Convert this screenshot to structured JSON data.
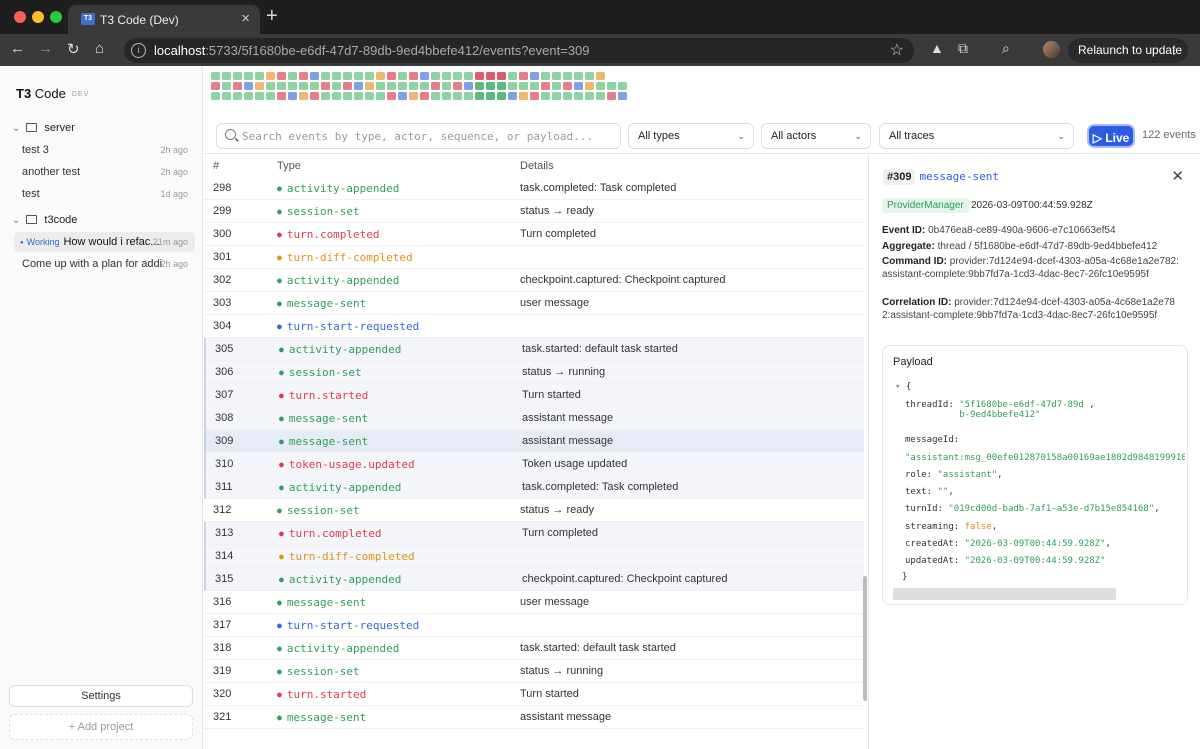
{
  "browser": {
    "tab_title": "T3 Code (Dev)",
    "tab_icon": "T3",
    "url_host": "localhost",
    "url_rest": ":5733/5f1680be-e6df-47d7-89db-9ed4bbefe412/events?event=309",
    "relaunch_label": "Relaunch to update"
  },
  "sidebar": {
    "brand": "T3",
    "brand_rest": " Code",
    "brand_badge": "DEV",
    "groups": [
      {
        "name": "server",
        "threads": [
          {
            "title": "test 3",
            "age": "2h ago"
          },
          {
            "title": "another test",
            "age": "2h ago"
          },
          {
            "title": "test",
            "age": "1d ago"
          }
        ]
      },
      {
        "name": "t3code",
        "threads": [
          {
            "status": "Working",
            "title": "How would i refac...",
            "age": "21m ago"
          },
          {
            "title": "Come up with a plan for addi...",
            "age": "2h ago"
          }
        ]
      }
    ],
    "settings_label": "Settings",
    "add_project_label": "+ Add project"
  },
  "toolbar": {
    "search_placeholder": "Search events by type, actor, sequence, or payload...",
    "types_filter": "All types",
    "actors_filter": "All actors",
    "traces_filter": "All traces",
    "live_label": "Live",
    "event_count": "122 events"
  },
  "table": {
    "headers": {
      "seq": "#",
      "type": "Type",
      "details": "Details"
    },
    "rows": [
      {
        "seq": "298",
        "type": "activity-appended",
        "color": "#2ea05a",
        "details": "task.completed: Task completed"
      },
      {
        "seq": "299",
        "type": "session-set",
        "color": "#2ea05a",
        "details": "status → ready"
      },
      {
        "seq": "300",
        "type": "turn.completed",
        "color": "#e03a4e",
        "details": "Turn completed"
      },
      {
        "seq": "301",
        "type": "turn-diff-completed",
        "color": "#e0940f",
        "details": ""
      },
      {
        "seq": "302",
        "type": "activity-appended",
        "color": "#2ea05a",
        "details": "checkpoint.captured: Checkpoint captured"
      },
      {
        "seq": "303",
        "type": "message-sent",
        "color": "#2ea05a",
        "details": "user message"
      },
      {
        "seq": "304",
        "type": "turn-start-requested",
        "color": "#3568e0",
        "details": ""
      },
      {
        "seq": "305",
        "type": "activity-appended",
        "color": "#2ea05a",
        "details": "task.started: default task started"
      },
      {
        "seq": "306",
        "type": "session-set",
        "color": "#2ea05a",
        "details": "status → running"
      },
      {
        "seq": "307",
        "type": "turn.started",
        "color": "#e03a4e",
        "details": "Turn started"
      },
      {
        "seq": "308",
        "type": "message-sent",
        "color": "#2ea05a",
        "details": "assistant message"
      },
      {
        "seq": "309",
        "type": "message-sent",
        "color": "#2ea05a",
        "details": "assistant message"
      },
      {
        "seq": "310",
        "type": "token-usage.updated",
        "color": "#e03a4e",
        "details": "Token usage updated"
      },
      {
        "seq": "311",
        "type": "activity-appended",
        "color": "#2ea05a",
        "details": "task.completed: Task completed"
      },
      {
        "seq": "312",
        "type": "session-set",
        "color": "#2ea05a",
        "details": "status → ready"
      },
      {
        "seq": "313",
        "type": "turn.completed",
        "color": "#e03a4e",
        "details": "Turn completed"
      },
      {
        "seq": "314",
        "type": "turn-diff-completed",
        "color": "#e0940f",
        "details": ""
      },
      {
        "seq": "315",
        "type": "activity-appended",
        "color": "#2ea05a",
        "details": "checkpoint.captured: Checkpoint captured"
      },
      {
        "seq": "316",
        "type": "message-sent",
        "color": "#2ea05a",
        "details": "user message"
      },
      {
        "seq": "317",
        "type": "turn-start-requested",
        "color": "#3568e0",
        "details": ""
      },
      {
        "seq": "318",
        "type": "activity-appended",
        "color": "#2ea05a",
        "details": "task.started: default task started"
      },
      {
        "seq": "319",
        "type": "session-set",
        "color": "#2ea05a",
        "details": "status → running"
      },
      {
        "seq": "320",
        "type": "turn.started",
        "color": "#e03a4e",
        "details": "Turn started"
      },
      {
        "seq": "321",
        "type": "message-sent",
        "color": "#2ea05a",
        "details": "assistant message"
      }
    ]
  },
  "detail": {
    "seq": "#309",
    "type": "message-sent",
    "actor": "ProviderManager",
    "timestamp": "2026-03-09T00:44:59.928Z",
    "event_id_label": "Event ID:",
    "event_id": "0b476ea8-ce89-490a-9606-e7c10663ef54",
    "aggregate_label": "Aggregate:",
    "aggregate": "thread / 5f1680be-e6df-47d7-89db-9ed4bbefe412",
    "command_id_label": "Command ID:",
    "command_id": "provider:7d124e94-dcef-4303-a05a-4c68e1a2e782:assistant-complete:9bb7fd7a-1cd3-4dac-8ec7-26fc10e9595f",
    "correlation_id_label": "Correlation ID:",
    "correlation_id": "provider:7d124e94-dcef-4303-a05a-4c68e1a2e782:assistant-complete:9bb7fd7a-1cd3-4dac-8ec7-26fc10e9595f",
    "payload_title": "Payload",
    "payload": {
      "threadId": "\"5f1680be-e6df-47d7-89db-9ed4bbefe412\"",
      "messageId": "\"assistant:msg_00efe012870158a00169ae1802d9848199918",
      "role": "\"assistant\"",
      "text": "\"\"",
      "turnId": "\"019cd00d-badb-7af1-a53e-d7b15e854168\"",
      "streaming": "false",
      "createdAt": "\"2026-03-09T00:44:59.928Z\"",
      "updatedAt": "\"2026-03-09T00:44:59.928Z\""
    }
  }
}
